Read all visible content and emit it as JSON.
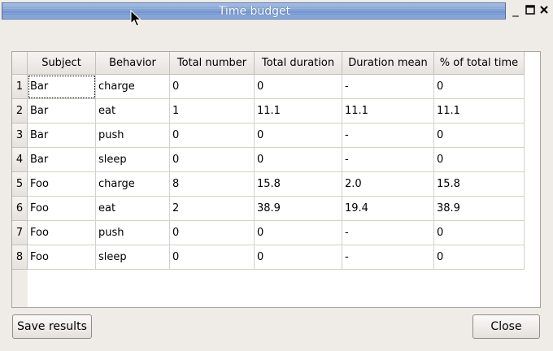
{
  "window": {
    "title": "Time budget",
    "controls": {
      "minimize": "_",
      "maximize": "□",
      "close": "✕"
    }
  },
  "table": {
    "columns": [
      "Subject",
      "Behavior",
      "Total number",
      "Total duration",
      "Duration mean",
      "% of total time"
    ],
    "row_numbers": [
      "1",
      "2",
      "3",
      "4",
      "5",
      "6",
      "7",
      "8"
    ],
    "rows": [
      [
        "Bar",
        "charge",
        "0",
        "0",
        "-",
        "0"
      ],
      [
        "Bar",
        "eat",
        "1",
        "11.1",
        "11.1",
        "11.1"
      ],
      [
        "Bar",
        "push",
        "0",
        "0",
        "-",
        "0"
      ],
      [
        "Bar",
        "sleep",
        "0",
        "0",
        "-",
        "0"
      ],
      [
        "Foo",
        "charge",
        "8",
        "15.8",
        "2.0",
        "15.8"
      ],
      [
        "Foo",
        "eat",
        "2",
        "38.9",
        "19.4",
        "38.9"
      ],
      [
        "Foo",
        "push",
        "0",
        "0",
        "-",
        "0"
      ],
      [
        "Foo",
        "sleep",
        "0",
        "0",
        "-",
        "0"
      ]
    ]
  },
  "buttons": {
    "save": "Save results",
    "close": "Close"
  }
}
